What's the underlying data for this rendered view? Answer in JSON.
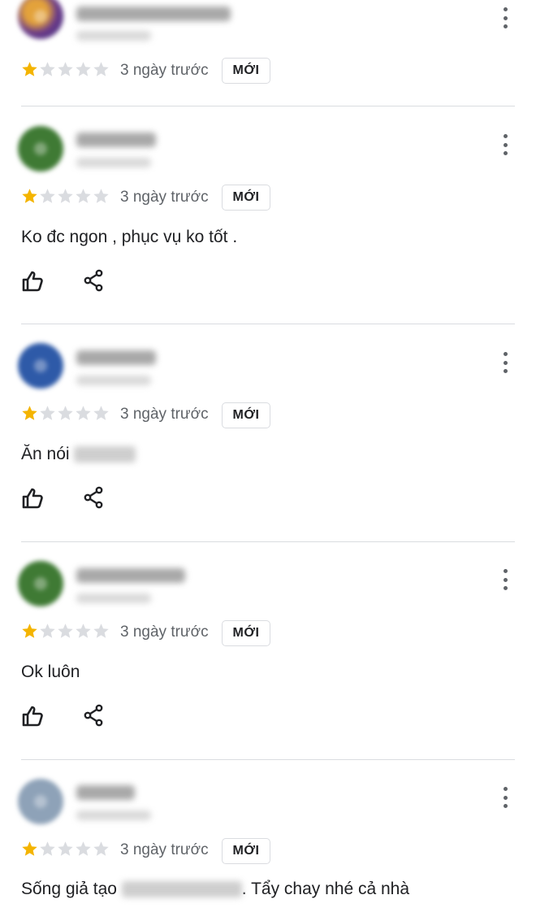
{
  "colors": {
    "star_filled": "#f4b400",
    "star_empty": "#dadce0",
    "divider": "#dadce0",
    "icon": "#202124",
    "meta_text": "#5f6368"
  },
  "icons": {
    "more": "more-vert-icon",
    "like": "thumb-up-icon",
    "share": "share-icon",
    "star": "star-icon"
  },
  "reviews": [
    {
      "rating": 1,
      "date": "3 ngày trước",
      "badge": "MỚI",
      "text": "",
      "text_after": ""
    },
    {
      "rating": 1,
      "date": "3 ngày trước",
      "badge": "MỚI",
      "text": "Ko đc ngon , phục vụ ko tốt .",
      "text_after": ""
    },
    {
      "rating": 1,
      "date": "3 ngày trước",
      "badge": "MỚI",
      "text": "Ăn nói",
      "text_after": ""
    },
    {
      "rating": 1,
      "date": "3 ngày trước",
      "badge": "MỚI",
      "text": "Ok luôn",
      "text_after": ""
    },
    {
      "rating": 1,
      "date": "3 ngày trước",
      "badge": "MỚI",
      "text": "Sống giả tạo",
      "text_after": ". Tẩy chay nhé cả nhà"
    }
  ]
}
